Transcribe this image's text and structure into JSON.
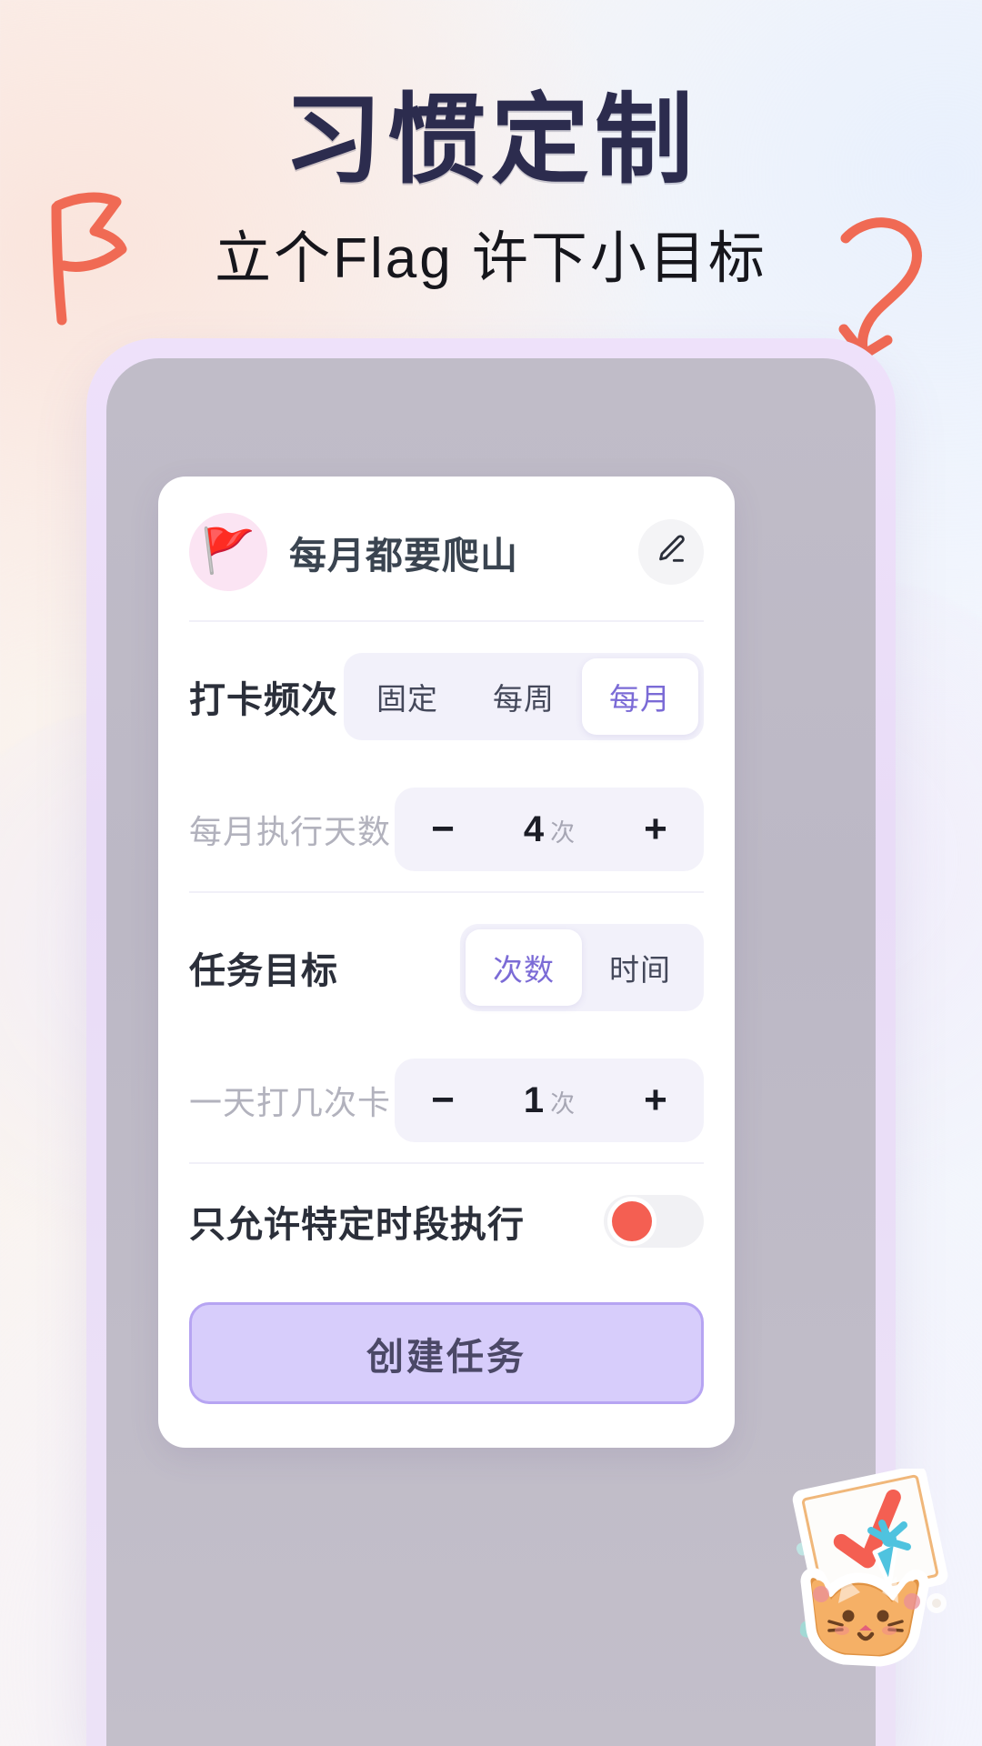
{
  "promo": {
    "title": "习惯定制",
    "subtitle": "立个Flag 许下小目标",
    "title_color": "#2c2c4e",
    "doodle_color": "#f06a54",
    "flag_doodle_icon": "hand-drawn-flag-icon",
    "arrow_doodle_icon": "hand-drawn-curved-arrow-icon"
  },
  "card": {
    "habit_emoji": "🚩",
    "habit_title": "每月都要爬山",
    "edit_icon": "pencil-icon",
    "frequency": {
      "label": "打卡频次",
      "options": [
        "固定",
        "每周",
        "每月"
      ],
      "selected": "每月"
    },
    "frequency_count": {
      "label": "每月执行天数",
      "minus": "−",
      "value": "4",
      "unit": "次",
      "plus": "+"
    },
    "goal": {
      "label": "任务目标",
      "options": [
        "次数",
        "时间"
      ],
      "selected": "次数"
    },
    "goal_count": {
      "label": "一天打几次卡",
      "minus": "−",
      "value": "1",
      "unit": "次",
      "plus": "+"
    },
    "time_restriction": {
      "label": "只允许特定时段执行",
      "state": "off",
      "knob_color": "#f45f52"
    },
    "cta_label": "创建任务",
    "cta_fill": "#d7cdfb",
    "cta_border": "#b6a4f2",
    "accent_purple": "#7b6bd6"
  },
  "mascot": {
    "name": "orange-cat-with-party-hat-and-checklist",
    "check_color": "#f45f52",
    "cat_color": "#f5b066",
    "hat_color": "#4fc3df"
  },
  "device": {
    "bezel_color": "#ece0f8",
    "screen_color": "#c0bcc8"
  }
}
